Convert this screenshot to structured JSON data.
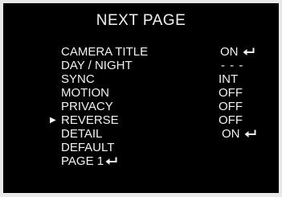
{
  "menu": {
    "title": "NEXT  PAGE",
    "cursor_symbol": "▶",
    "selected_item": "REVERSE",
    "items": [
      {
        "label": "CAMERA  TITLE",
        "value": "ON",
        "enter": true
      },
      {
        "label": "DAY / NIGHT",
        "value": "- - -",
        "enter": false
      },
      {
        "label": "SYNC",
        "value": "INT",
        "enter": false
      },
      {
        "label": "MOTION",
        "value": "OFF",
        "enter": false
      },
      {
        "label": "PRIVACY",
        "value": "OFF",
        "enter": false
      },
      {
        "label": "REVERSE",
        "value": "OFF",
        "enter": false
      },
      {
        "label": "DETAIL",
        "value": "ON",
        "enter": true
      },
      {
        "label": "DEFAULT",
        "value": "",
        "enter": false
      },
      {
        "label": "PAGE  1",
        "value": "",
        "enter": true
      }
    ]
  },
  "icons": {
    "enter": "enter-arrow-icon",
    "cursor": "cursor-triangle-icon"
  },
  "colors": {
    "background": "#000000",
    "text": "#f2f2f2",
    "frame": "#e8e8e8"
  }
}
